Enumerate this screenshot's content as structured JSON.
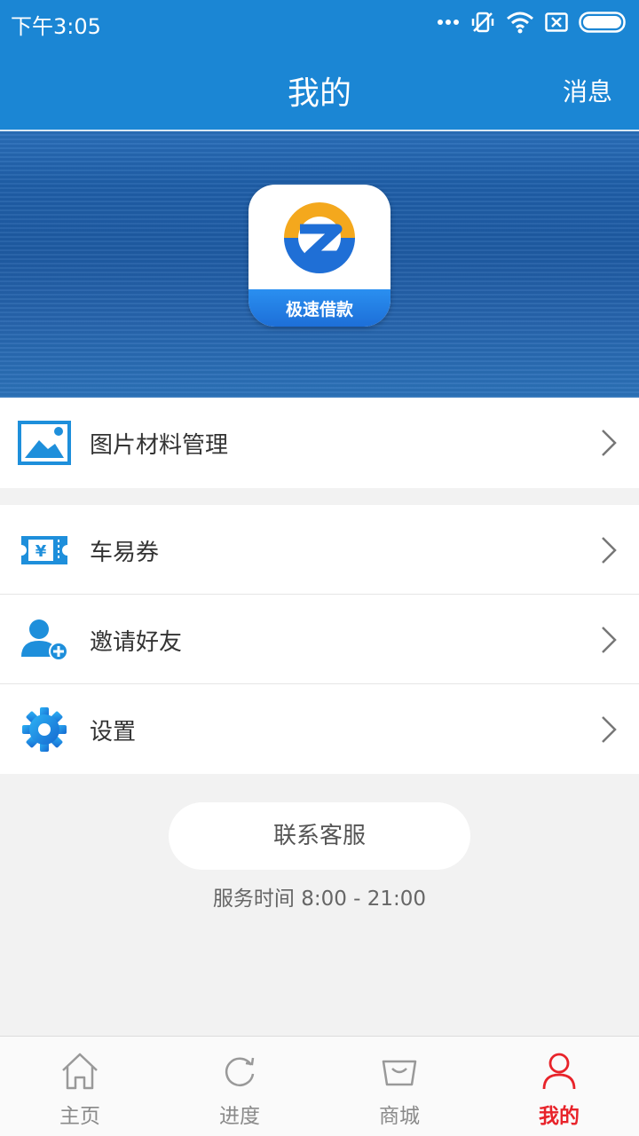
{
  "status_bar": {
    "time": "下午3:05"
  },
  "header": {
    "title": "我的",
    "action": "消息"
  },
  "hero": {
    "app_name": "极速借款"
  },
  "menu": {
    "group1": [
      {
        "label": "图片材料管理",
        "icon": "image-icon"
      }
    ],
    "group2": [
      {
        "label": "车易券",
        "icon": "coupon-icon"
      },
      {
        "label": "邀请好友",
        "icon": "add-user-icon"
      },
      {
        "label": "设置",
        "icon": "gear-icon"
      }
    ]
  },
  "contact": {
    "button": "联系客服",
    "service_time": "服务时间 8:00 - 21:00"
  },
  "tabs": [
    {
      "label": "主页",
      "icon": "home-icon",
      "active": false
    },
    {
      "label": "进度",
      "icon": "refresh-icon",
      "active": false
    },
    {
      "label": "商城",
      "icon": "shopping-bag-icon",
      "active": false
    },
    {
      "label": "我的",
      "icon": "person-icon",
      "active": true
    }
  ],
  "colors": {
    "primary": "#1b86d4",
    "active_tab": "#e8232a",
    "icon_blue": "#1e8fdb"
  }
}
